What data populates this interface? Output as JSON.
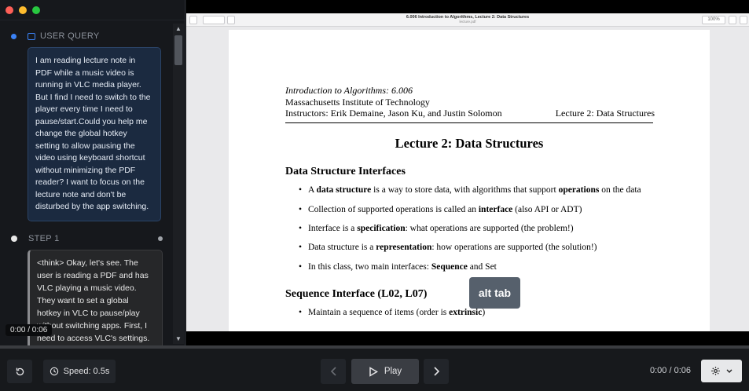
{
  "left_panel": {
    "user_query_label": "USER QUERY",
    "user_query_text": "I am reading lecture note in PDF while a music video is running in VLC media player. But I find I need to switch to the player every time I need to pause/start.Could you help me change the global hotkey setting to allow pausing the video using keyboard shortcut without minimizing the PDF reader? I want to focus on the lecture note and don't be disturbed by the app switching.",
    "step_label": "STEP 1",
    "step_text": "<think> Okay, let's see. The user is reading a PDF and has VLC playing a music video. They want to set a global hotkey in VLC to pause/play without switching apps. First, I need to access VLC's settings.",
    "time_badge": "0:00 / 0:06"
  },
  "pdf": {
    "window_title": "6.006 Introduction to Algorithms, Lecture 2: Data Structures",
    "window_subtitle": "lecture.pdf",
    "zoom": "100%",
    "page": {
      "course": "Introduction to Algorithms: 6.006",
      "institution": "Massachusetts Institute of Technology",
      "instructors": "Instructors: Erik Demaine, Jason Ku, and Justin Solomon",
      "lecture_right": "Lecture 2: Data Structures",
      "title": "Lecture 2: Data Structures",
      "section1": "Data Structure Interfaces",
      "items1": [
        {
          "pre": "A ",
          "b1": "data structure",
          "mid": " is a way to store data, with algorithms that support ",
          "b2": "operations",
          "post": " on the data"
        },
        {
          "pre": "Collection of supported operations is called an ",
          "b1": "interface",
          "mid": " (also API or ADT)",
          "b2": "",
          "post": ""
        },
        {
          "pre": "Interface is a ",
          "b1": "specification",
          "mid": ": what operations are supported (the problem!)",
          "b2": "",
          "post": ""
        },
        {
          "pre": "Data structure is a ",
          "b1": "representation",
          "mid": ": how operations are supported (the solution!)",
          "b2": "",
          "post": ""
        },
        {
          "pre": "In this class, two main interfaces: ",
          "b1": "Sequence",
          "mid": " and Set",
          "b2": "",
          "post": ""
        }
      ],
      "section2": "Sequence Interface (L02, L07)",
      "items2": [
        {
          "pre": "Maintain a sequence of items (order is ",
          "b1": "extrinsic",
          "mid": ")",
          "b2": "",
          "post": ""
        }
      ]
    },
    "tooltip": "alt tab"
  },
  "bottom_bar": {
    "speed_label": "Speed: 0.5s",
    "play_label": "Play",
    "time_display": "0:00 / 0:06"
  },
  "colors": {
    "accent_blue": "#3b82f6",
    "panel_bg": "#16181c",
    "query_card_bg": "#1b2a40"
  }
}
